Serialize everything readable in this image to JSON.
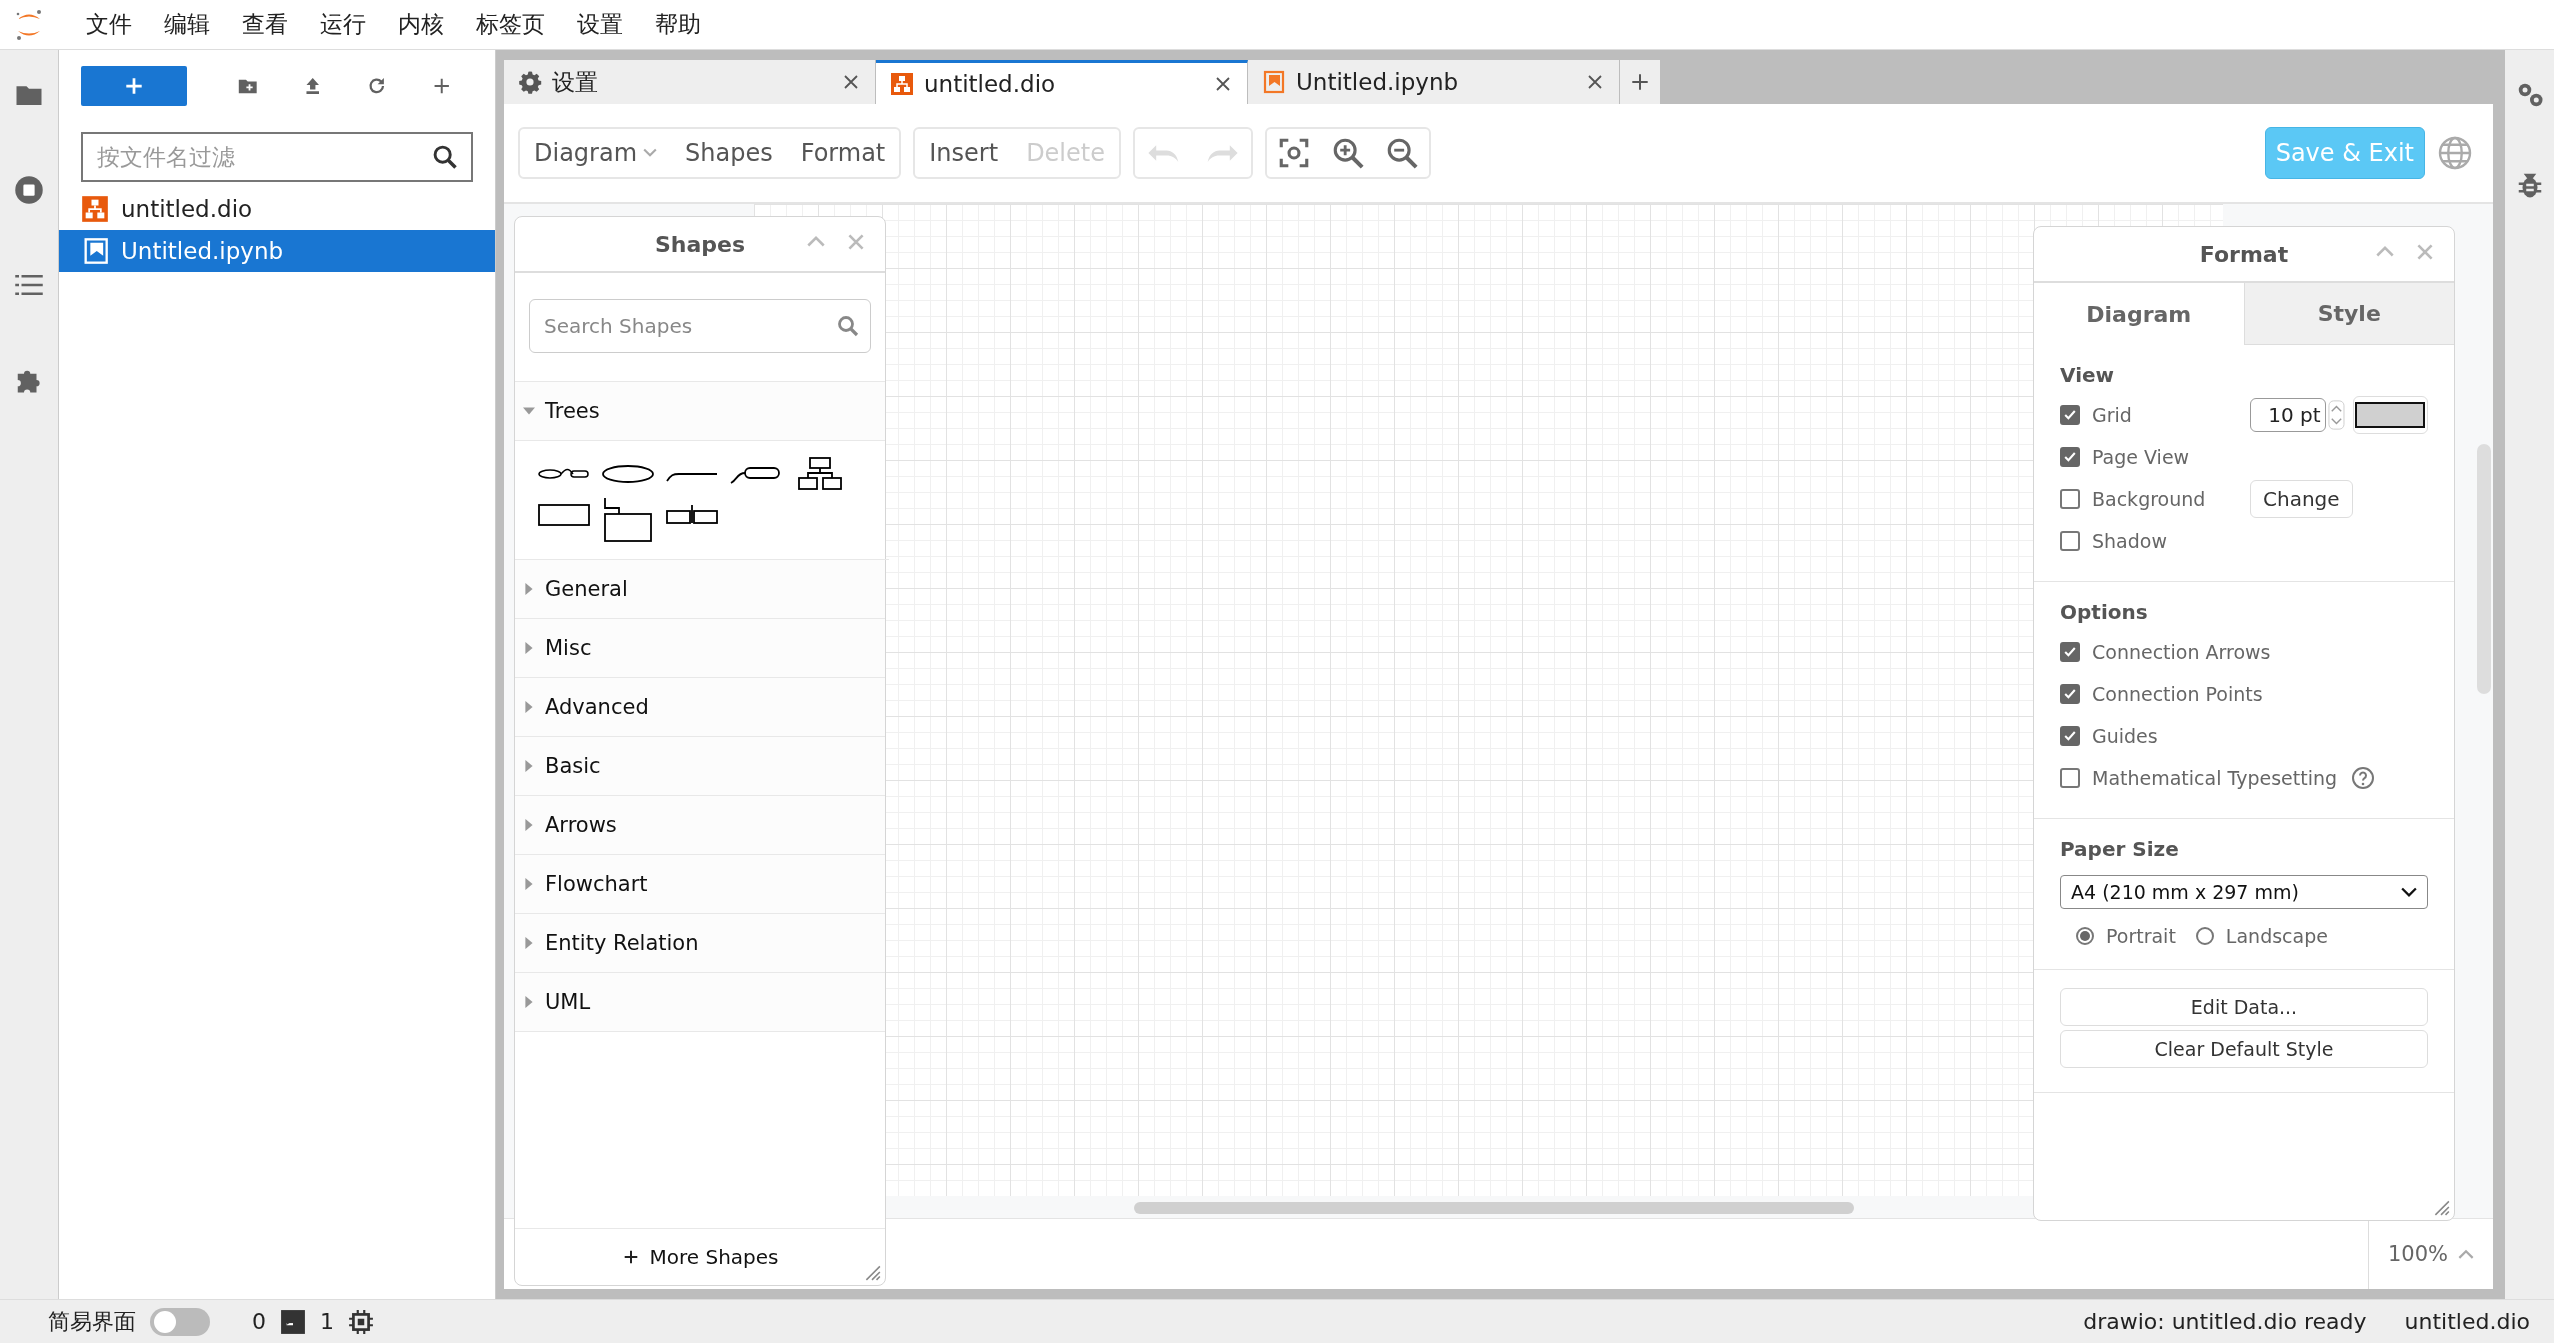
{
  "menu_bar": {
    "items": [
      "文件",
      "编辑",
      "查看",
      "运行",
      "内核",
      "标签页",
      "设置",
      "帮助"
    ]
  },
  "file_browser": {
    "filter": {
      "placeholder": "按文件名过滤"
    },
    "files": [
      {
        "name": "untitled.dio",
        "kind": "drawio",
        "selected": false
      },
      {
        "name": "Untitled.ipynb",
        "kind": "notebook",
        "selected": true
      }
    ]
  },
  "tabs": [
    {
      "label": "设置",
      "kind": "settings",
      "selected": false
    },
    {
      "label": "untitled.dio",
      "kind": "drawio",
      "selected": true
    },
    {
      "label": "Untitled.ipynb",
      "kind": "notebook",
      "selected": false
    }
  ],
  "toolbar": {
    "view_menus": [
      {
        "label": "Diagram",
        "dropdown": true
      },
      {
        "label": "Shapes",
        "dropdown": false
      },
      {
        "label": "Format",
        "dropdown": false
      }
    ],
    "edit_actions": [
      {
        "label": "Insert",
        "disabled": false
      },
      {
        "label": "Delete",
        "disabled": true
      }
    ],
    "undo_disabled": true,
    "redo_disabled": true,
    "save_button": "Save & Exit"
  },
  "shapes_panel": {
    "title": "Shapes",
    "search": {
      "placeholder": "Search Shapes"
    },
    "categories": [
      {
        "label": "Trees",
        "expanded": true
      },
      {
        "label": "General",
        "expanded": false
      },
      {
        "label": "Misc",
        "expanded": false
      },
      {
        "label": "Advanced",
        "expanded": false
      },
      {
        "label": "Basic",
        "expanded": false
      },
      {
        "label": "Arrows",
        "expanded": false
      },
      {
        "label": "Flowchart",
        "expanded": false
      },
      {
        "label": "Entity Relation",
        "expanded": false
      },
      {
        "label": "UML",
        "expanded": false
      }
    ],
    "more_button": "More Shapes"
  },
  "format_panel": {
    "title": "Format",
    "tabs": [
      {
        "label": "Diagram",
        "selected": true
      },
      {
        "label": "Style",
        "selected": false
      }
    ],
    "view": {
      "heading": "View",
      "options": [
        {
          "kind": "grid",
          "label": "Grid",
          "checked": true,
          "value": "10 pt"
        },
        {
          "kind": "plain",
          "label": "Page View",
          "checked": true
        },
        {
          "kind": "background",
          "label": "Background",
          "checked": false,
          "button": "Change"
        },
        {
          "kind": "plain",
          "label": "Shadow",
          "checked": false
        }
      ]
    },
    "options": {
      "heading": "Options",
      "items": [
        {
          "label": "Connection Arrows",
          "checked": true,
          "help": false
        },
        {
          "label": "Connection Points",
          "checked": true,
          "help": false
        },
        {
          "label": "Guides",
          "checked": true,
          "help": false
        },
        {
          "label": "Mathematical Typesetting",
          "checked": false,
          "help": true
        }
      ]
    },
    "paper": {
      "heading": "Paper Size",
      "value": "A4 (210 mm x 297 mm)",
      "orientations": [
        {
          "label": "Portrait",
          "selected": true
        },
        {
          "label": "Landscape",
          "selected": false
        }
      ]
    },
    "buttons": [
      "Edit Data...",
      "Clear Default Style"
    ]
  },
  "zoom": "100%",
  "status_bar": {
    "simple_mode": {
      "label": "简易界面",
      "on": false
    },
    "terminals": "0",
    "kernels": "1",
    "message": "drawio: untitled.dio ready",
    "file": "untitled.dio"
  }
}
